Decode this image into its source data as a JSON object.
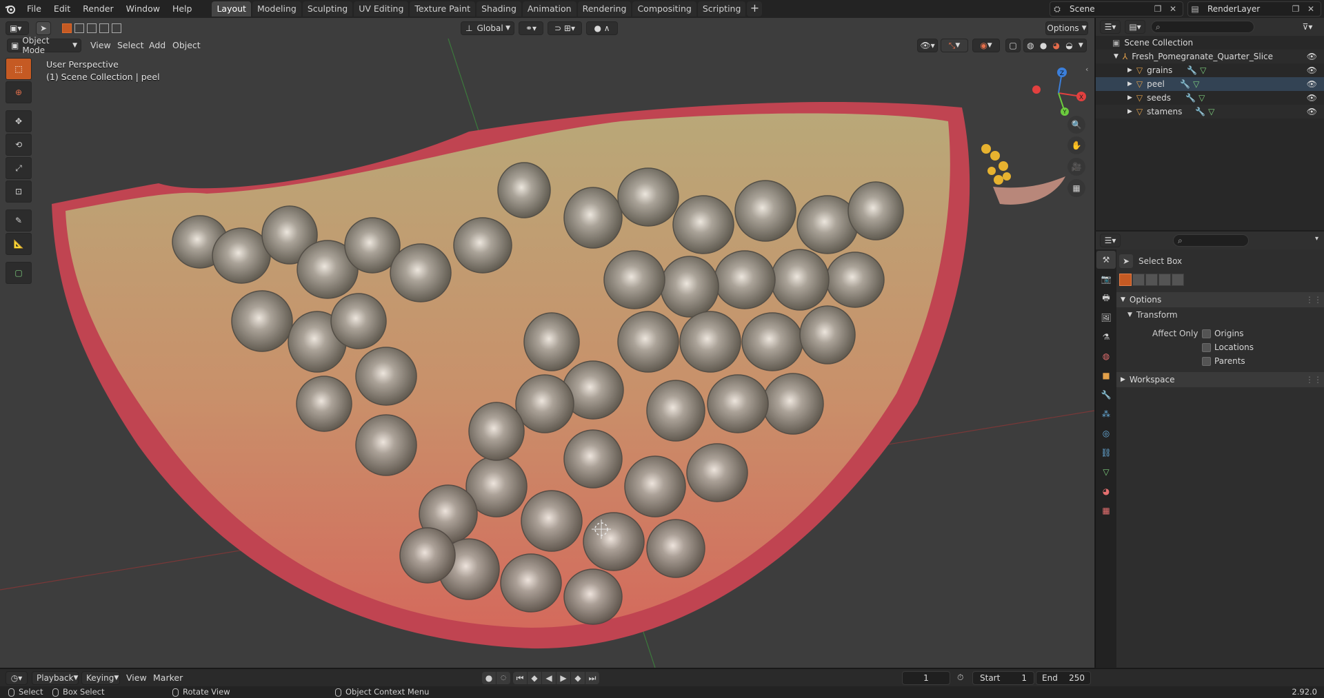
{
  "app": {
    "menus": [
      "File",
      "Edit",
      "Render",
      "Window",
      "Help"
    ],
    "workspaces": [
      "Layout",
      "Modeling",
      "Sculpting",
      "UV Editing",
      "Texture Paint",
      "Shading",
      "Animation",
      "Rendering",
      "Compositing",
      "Scripting"
    ],
    "active_workspace": "Layout",
    "add_tab": "+",
    "scene": "Scene",
    "view_layer": "RenderLayer",
    "version": "2.92.0"
  },
  "viewport": {
    "mode": "Object Mode",
    "menus": [
      "View",
      "Select",
      "Add",
      "Object"
    ],
    "transform_orientation": "Global",
    "options_label": "Options",
    "perspective_label": "User Perspective",
    "context_label": "(1) Scene Collection | peel",
    "gizmo_axes": {
      "x": "X",
      "y": "Y",
      "z": "Z"
    },
    "colors": {
      "x_axis": "#e2403f",
      "y_axis": "#6ccb3e",
      "z_axis": "#3b7fdb",
      "active_tool": "#c55a23"
    }
  },
  "outliner": {
    "search_placeholder": "",
    "root": "Scene Collection",
    "collection": "Fresh_Pomegranate_Quarter_Slice",
    "objects": [
      "grains",
      "peel",
      "seeds",
      "stamens"
    ]
  },
  "properties": {
    "search_placeholder": "",
    "tool_name": "Select Box",
    "panels": {
      "options": "Options",
      "transform": "Transform",
      "affect_only": "Affect Only",
      "checkboxes": [
        "Origins",
        "Locations",
        "Parents"
      ],
      "workspace": "Workspace"
    }
  },
  "timeline": {
    "menus": {
      "playback": "Playback",
      "keying": "Keying",
      "view": "View",
      "marker": "Marker"
    },
    "current_frame": "1",
    "start_label": "Start",
    "start": "1",
    "end_label": "End",
    "end": "250"
  },
  "statusbar": {
    "select": "Select",
    "box_select": "Box Select",
    "rotate_view": "Rotate View",
    "context_menu": "Object Context Menu"
  }
}
